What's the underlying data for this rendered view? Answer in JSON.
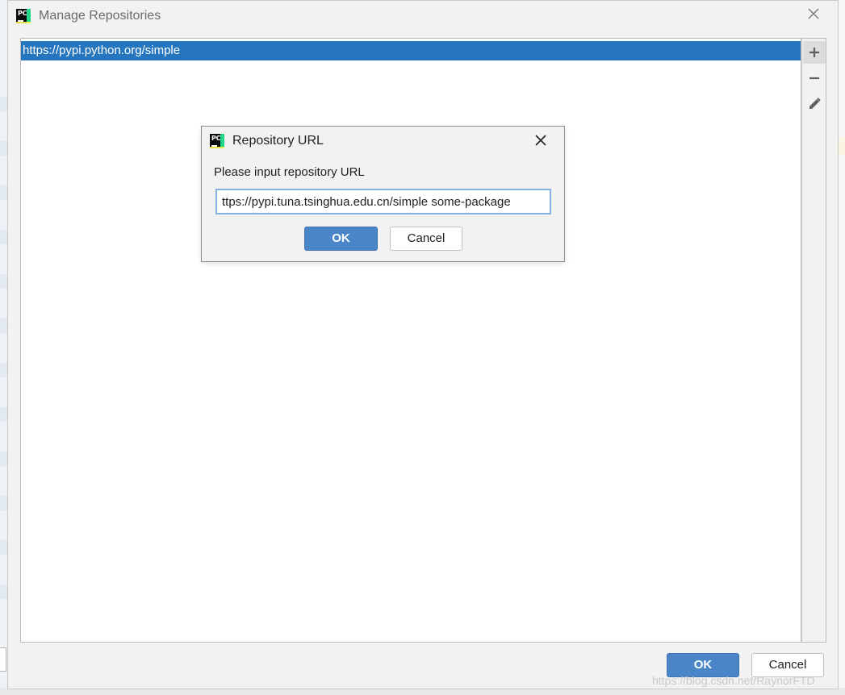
{
  "main_dialog": {
    "title": "Manage Repositories",
    "repositories": [
      "https://pypi.python.org/simple"
    ],
    "ok_label": "OK",
    "cancel_label": "Cancel"
  },
  "inner_dialog": {
    "title": "Repository URL",
    "prompt": "Please input repository URL",
    "url_value": "ttps://pypi.tuna.tsinghua.edu.cn/simple some-package",
    "ok_label": "OK",
    "cancel_label": "Cancel"
  },
  "watermark": "https://blog.csdn.net/RaynorFTD",
  "icons": {
    "app": "pycharm-icon",
    "close": "close-icon",
    "add": "plus-icon",
    "remove": "minus-icon",
    "edit": "pencil-icon"
  },
  "colors": {
    "selection": "#2675bf",
    "primary_button": "#4a86c7",
    "focus_border": "#85b1e0"
  }
}
